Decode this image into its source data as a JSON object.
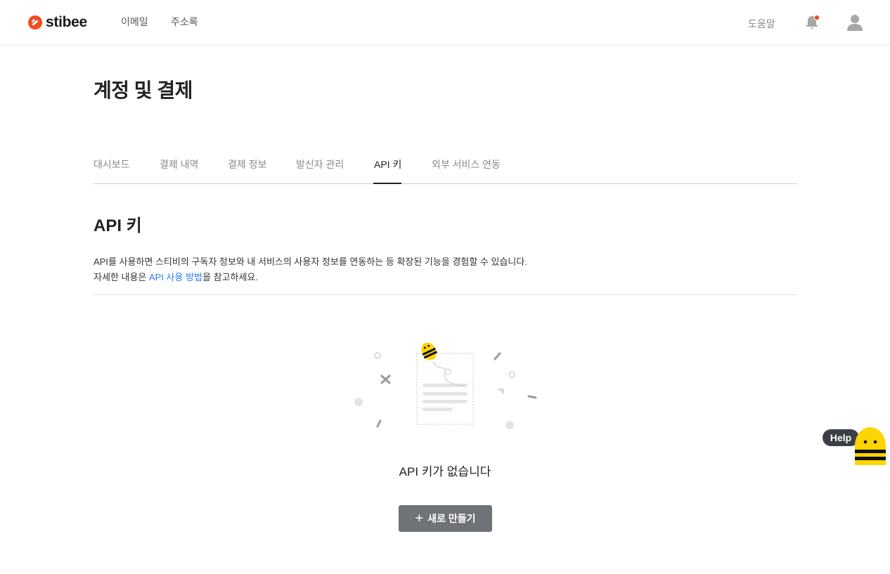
{
  "header": {
    "logo_text": "stibee",
    "nav": [
      "이메일",
      "주소록"
    ],
    "help_label": "도움말",
    "accent_color": "#f04b23"
  },
  "page": {
    "title": "계정 및 결제"
  },
  "tabs": [
    {
      "label": "대시보드",
      "active": false
    },
    {
      "label": "결제 내역",
      "active": false
    },
    {
      "label": "결제 정보",
      "active": false
    },
    {
      "label": "발신자 관리",
      "active": false
    },
    {
      "label": "API 키",
      "active": true
    },
    {
      "label": "외부 서비스 연동",
      "active": false
    }
  ],
  "section": {
    "title": "API 키",
    "desc_line1": "API를 사용하면 스티비의 구독자 정보와 내 서비스의 사용자 정보를 연동하는 등 확장된 기능을 경험할 수 있습니다.",
    "desc_line2_prefix": "자세한 내용은 ",
    "desc_link": "API 사용 방법",
    "desc_line2_suffix": "을 참고하세요.",
    "link_color": "#2b7de9"
  },
  "empty_state": {
    "message": "API 키가 없습니다",
    "button_label": "새로 만들기",
    "button_icon": "plus-icon"
  },
  "help_widget": {
    "label": "Help",
    "icon": "bee-mascot-icon"
  }
}
